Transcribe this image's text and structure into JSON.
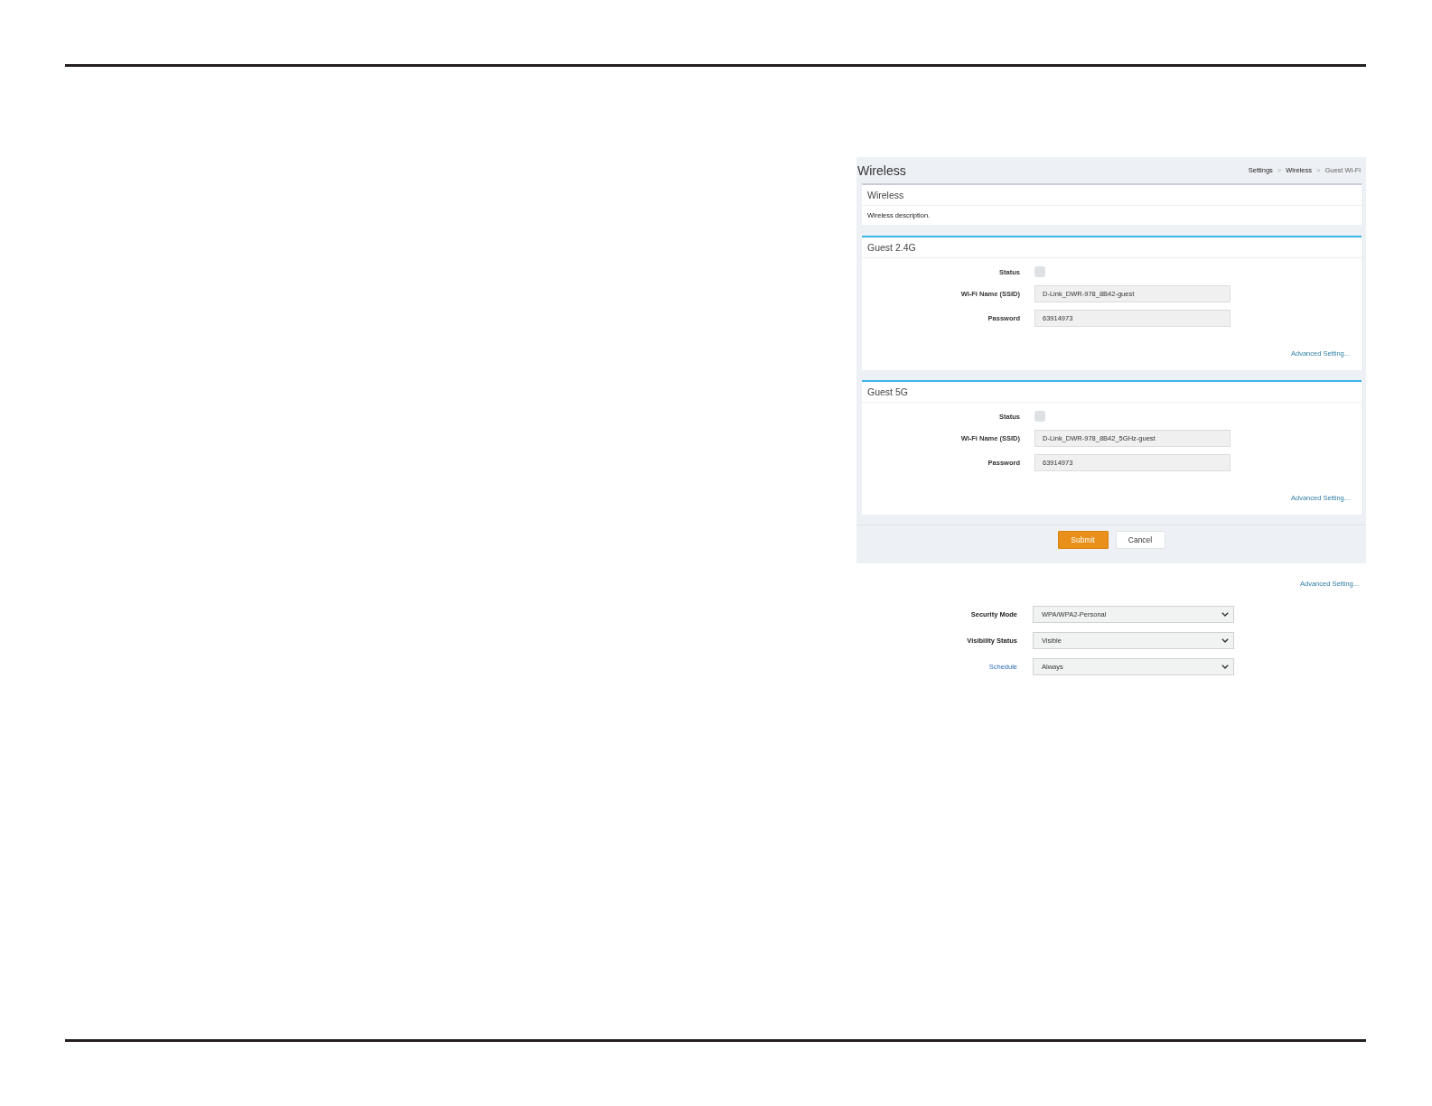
{
  "screenshot": {
    "title": "Wireless",
    "breadcrumb": [
      {
        "kind": "link",
        "text": "Settings"
      },
      {
        "kind": "separator",
        "text": ">"
      },
      {
        "kind": "link",
        "text": "Wireless"
      },
      {
        "kind": "separator",
        "text": ">"
      },
      {
        "kind": "current",
        "text": "Guest Wi-Fi"
      }
    ],
    "intro_card": {
      "title": "Wireless",
      "description": "Wireless description."
    },
    "sections": [
      {
        "title": "Guest 2.4G",
        "fields": [
          {
            "kind": "checkbox",
            "label": "Status",
            "checked": false
          },
          {
            "kind": "text",
            "label": "Wi-Fi Name (SSID)",
            "value": "D-Link_DWR-978_8B42-guest"
          },
          {
            "kind": "text",
            "label": "Password",
            "value": "63914973"
          }
        ],
        "link": "Advanced Setting..."
      },
      {
        "title": "Guest 5G",
        "fields": [
          {
            "kind": "checkbox",
            "label": "Status",
            "checked": false
          },
          {
            "kind": "text",
            "label": "Wi-Fi Name (SSID)",
            "value": "D-Link_DWR-978_8B42_5GHz-guest"
          },
          {
            "kind": "text",
            "label": "Password",
            "value": "63914973"
          }
        ],
        "link": "Advanced Setting..."
      }
    ],
    "buttons": [
      {
        "kind": "submit",
        "label": "Submit"
      },
      {
        "kind": "cancel",
        "label": "Cancel"
      }
    ]
  },
  "advanced_link": "Advanced Setting...",
  "settings": [
    {
      "label": "Security Mode",
      "label_link": false,
      "value": "WPA/WPA2-Personal"
    },
    {
      "label": "Visibility Status",
      "label_link": false,
      "value": "Visible"
    },
    {
      "label": "Schedule",
      "label_link": true,
      "value": "Always"
    }
  ]
}
